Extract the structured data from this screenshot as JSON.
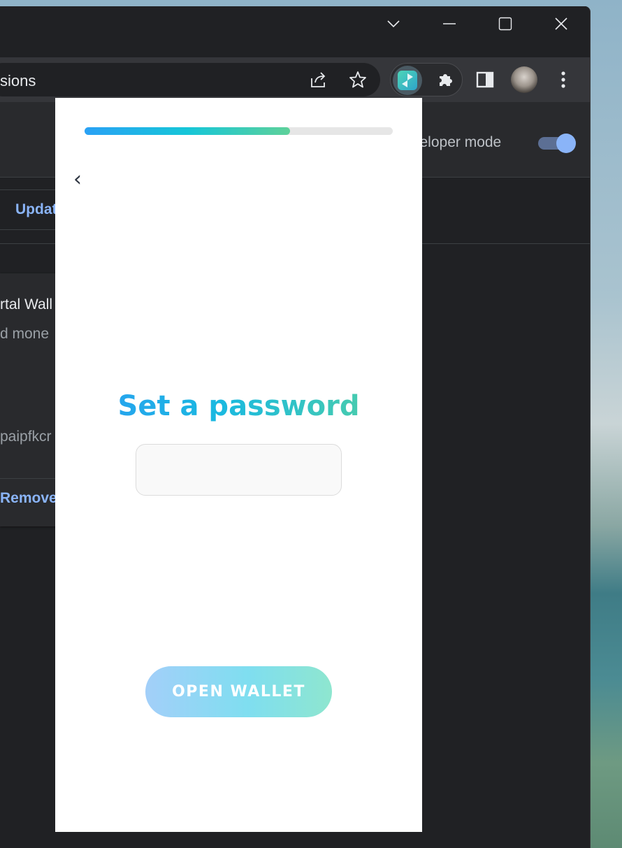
{
  "browser": {
    "omnibox_text": "sions",
    "icons": [
      "share-icon",
      "star-icon",
      "puzzle-icon",
      "sidepanel-icon",
      "kebab-icon"
    ]
  },
  "extensions_page": {
    "developer_mode_label": "veloper mode",
    "developer_mode_on": true,
    "update_label": "Updat",
    "card": {
      "title": "rtal Wall",
      "description": "d mone",
      "id": "paipfkcr",
      "remove_label": "Remove"
    }
  },
  "popup": {
    "progress_fraction": 0.667,
    "back_glyph": "‹",
    "title": "Set a password",
    "password_value": "",
    "open_button_label": "OPEN WALLET",
    "colors": {
      "gradient_start": "#2b9af5",
      "gradient_mid": "#1ab9e0",
      "gradient_end": "#5ad39a"
    }
  }
}
